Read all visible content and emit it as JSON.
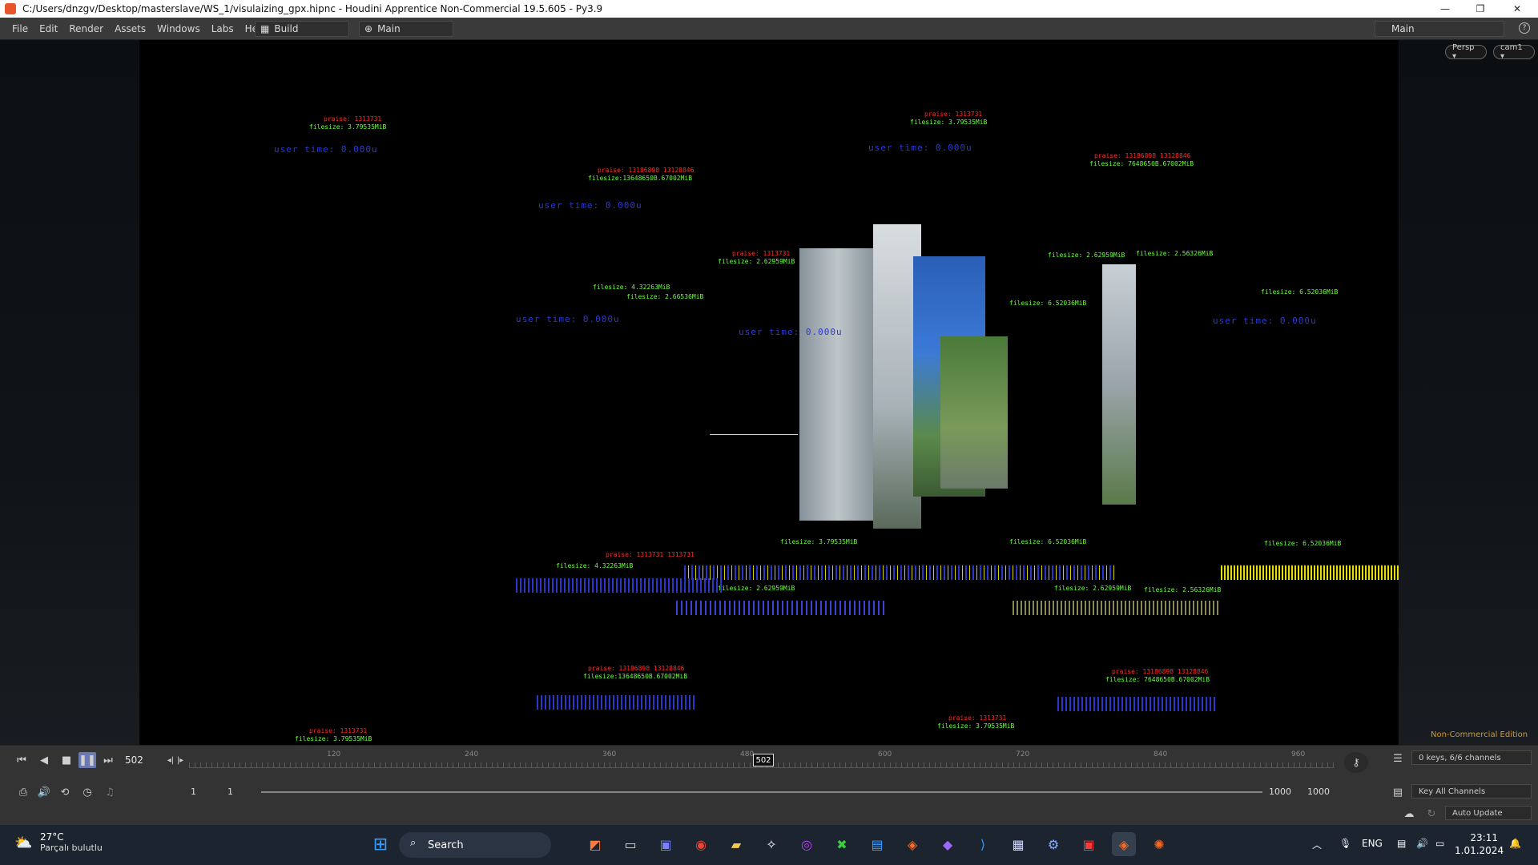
{
  "window": {
    "title": "C:/Users/dnzgv/Desktop/masterslave/WS_1/visulaizing_gpx.hipnc - Houdini Apprentice Non-Commercial 19.5.605 - Py3.9",
    "minimize": "—",
    "maximize": "❐",
    "close": "✕"
  },
  "menubar": {
    "items": [
      "File",
      "Edit",
      "Render",
      "Assets",
      "Windows",
      "Labs",
      "Help"
    ],
    "desktop_build": "Build",
    "desktop_main": "Main",
    "desk_right": "Main"
  },
  "viewport": {
    "persp_button": "Persp ▾",
    "cam_button": "cam1 ▾",
    "edition_label": "Non-Commercial Edition",
    "overlay": {
      "filesize_1": "filesize: 3.79535MiB",
      "filesize_2": "filesize: 2.62959MiB",
      "filesize_3": "filesize: 6.52036MiB",
      "filesize_4": "filesize: 2.56326MiB",
      "filesize_5": "filesize: 4.32263MiB",
      "filesize_6": "filesize: 2.66536MiB",
      "usertime_1": "user time: 0.000u",
      "usertime_2": "user time: 0.000u",
      "usertime_3": "user time: 0.000u"
    }
  },
  "timeline": {
    "current_frame": "502",
    "playhead_frame": "502",
    "ruler_ticks": [
      "120",
      "240",
      "360",
      "480",
      "600",
      "720",
      "840",
      "960"
    ],
    "start_frame": "1",
    "start_frame_2": "1",
    "end_frame": "1000",
    "end_frame_2": "1000",
    "keys_label": "0 keys, 6/6 channels",
    "key_all_label": "Key All Channels",
    "auto_update": "Auto Update"
  },
  "taskbar": {
    "weather_temp": "27°C",
    "weather_desc": "Parçalı bulutlu",
    "search_label": "Search",
    "language": "ENG",
    "time": "23:11",
    "date": "1.01.2024"
  },
  "colors": {
    "label_red": "#ff2a2a",
    "label_green": "#6cff3a",
    "label_blue": "#2a3ad0",
    "edition": "#d49a20",
    "houdini_accent": "#e8552b"
  }
}
